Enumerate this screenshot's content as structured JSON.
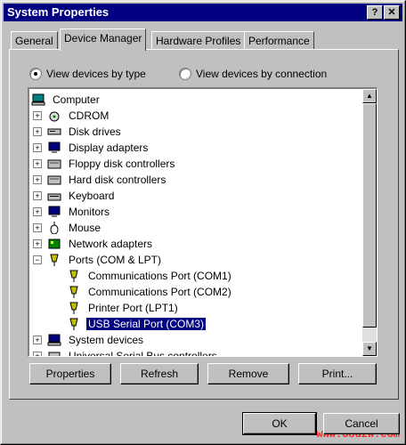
{
  "window": {
    "title": "System Properties",
    "help_glyph": "?",
    "close_glyph": "✕"
  },
  "tabs": [
    {
      "label": "General"
    },
    {
      "label": "Device Manager"
    },
    {
      "label": "Hardware Profiles"
    },
    {
      "label": "Performance"
    }
  ],
  "view": {
    "by_type": "View devices by type",
    "by_connection": "View devices by connection",
    "selected": "by_type"
  },
  "tree": {
    "root": "Computer",
    "items": [
      {
        "label": "CDROM",
        "icon": "cdrom-icon"
      },
      {
        "label": "Disk drives",
        "icon": "disk-drive-icon"
      },
      {
        "label": "Display adapters",
        "icon": "monitor-icon"
      },
      {
        "label": "Floppy disk controllers",
        "icon": "controller-icon"
      },
      {
        "label": "Hard disk controllers",
        "icon": "controller-icon"
      },
      {
        "label": "Keyboard",
        "icon": "keyboard-icon"
      },
      {
        "label": "Monitors",
        "icon": "monitor-icon"
      },
      {
        "label": "Mouse",
        "icon": "mouse-icon"
      },
      {
        "label": "Network adapters",
        "icon": "network-icon"
      },
      {
        "label": "Ports (COM & LPT)",
        "icon": "port-icon",
        "expanded": true
      },
      {
        "label": "Communications Port (COM1)",
        "icon": "port-icon",
        "child": true
      },
      {
        "label": "Communications Port (COM2)",
        "icon": "port-icon",
        "child": true
      },
      {
        "label": "Printer Port (LPT1)",
        "icon": "port-icon",
        "child": true
      },
      {
        "label": "USB Serial Port (COM3)",
        "icon": "port-icon",
        "child": true,
        "selected": true
      },
      {
        "label": "System devices",
        "icon": "computer-icon"
      },
      {
        "label": "Universal Serial Bus controllers",
        "icon": "usb-icon"
      }
    ]
  },
  "buttons": {
    "properties": "Properties",
    "refresh": "Refresh",
    "remove": "Remove",
    "print": "Print...",
    "ok": "OK",
    "cancel": "Cancel"
  },
  "watermark": "www.88dzw.com",
  "colors": {
    "title_bar": "#000080",
    "selection": "#000080",
    "face": "#c0c0c0"
  }
}
